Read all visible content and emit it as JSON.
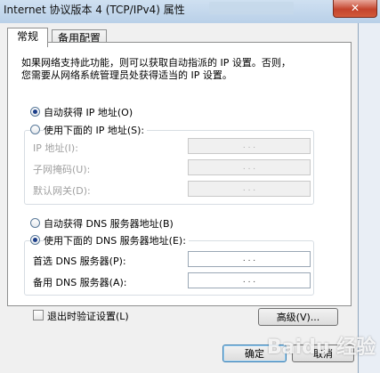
{
  "window": {
    "title": "Internet 协议版本 4 (TCP/IPv4) 属性",
    "close_symbol": "✕"
  },
  "tabs": [
    {
      "label": "常规"
    },
    {
      "label": "备用配置"
    }
  ],
  "intro": {
    "line1": "如果网络支持此功能，则可以获取自动指派的 IP 设置。否则，",
    "line2": "您需要从网络系统管理员处获得适当的 IP 设置。"
  },
  "ip": {
    "auto_label": "自动获得 IP 地址(O)",
    "manual_label": "使用下面的 IP 地址(S):",
    "fields": [
      {
        "label": "IP 地址(I):",
        "value": ". . ."
      },
      {
        "label": "子网掩码(U):",
        "value": ". . ."
      },
      {
        "label": "默认网关(D):",
        "value": ". . ."
      }
    ]
  },
  "dns": {
    "auto_label": "自动获得 DNS 服务器地址(B)",
    "manual_label": "使用下面的 DNS 服务器地址(E):",
    "fields": [
      {
        "label": "首选 DNS 服务器(P):",
        "value": ". . ."
      },
      {
        "label": "备用 DNS 服务器(A):",
        "value": ". . ."
      }
    ]
  },
  "validate_label": "退出时验证设置(L)",
  "advanced_label": "高级(V)...",
  "ok_label": "确定",
  "cancel_label": "取消",
  "watermark": "Baidu 经验",
  "colors": {
    "accent": "#1d3f8a",
    "close": "#c4442c"
  }
}
